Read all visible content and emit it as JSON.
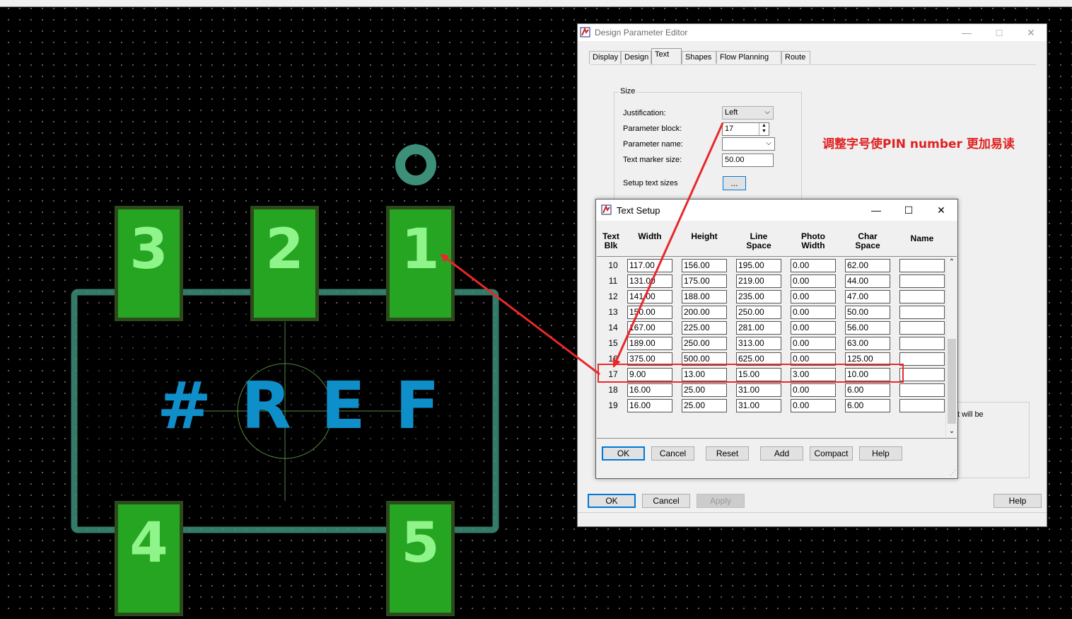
{
  "pcb": {
    "pads": [
      {
        "label": "3"
      },
      {
        "label": "2"
      },
      {
        "label": "1"
      },
      {
        "label": "4"
      },
      {
        "label": "5"
      }
    ],
    "refdes": "#REF",
    "colors": {
      "pad_fill": "#26a522",
      "pad_label": "#8ff58a",
      "outline": "#3d8f7a",
      "refdes": "#0f8fc9"
    }
  },
  "dpe": {
    "title": "Design Parameter Editor",
    "tabs": [
      "Display",
      "Design",
      "Text",
      "Shapes",
      "Flow Planning",
      "Route"
    ],
    "active_tab": "Text",
    "size_group": "Size",
    "justification_label": "Justification:",
    "justification_value": "Left",
    "param_block_label": "Parameter block:",
    "param_block_value": "17",
    "param_name_label": "Parameter name:",
    "param_name_value": "",
    "text_marker_label": "Text marker size:",
    "text_marker_value": "50.00",
    "setup_text_label": "Setup text sizes",
    "setup_text_button": "...",
    "partial_text": "t will be",
    "buttons": {
      "ok": "OK",
      "cancel": "Cancel",
      "apply": "Apply",
      "help": "Help"
    }
  },
  "text_setup": {
    "title": "Text Setup",
    "headers": {
      "blk": "Text\nBlk",
      "width": "Width",
      "height": "Height",
      "line": "Line\nSpace",
      "photo": "Photo\nWidth",
      "char": "Char\nSpace",
      "name": "Name"
    },
    "rows": [
      {
        "blk": "10",
        "width": "117.00",
        "height": "156.00",
        "line": "195.00",
        "photo": "0.00",
        "char": "62.00",
        "name": ""
      },
      {
        "blk": "11",
        "width": "131.00",
        "height": "175.00",
        "line": "219.00",
        "photo": "0.00",
        "char": "44.00",
        "name": ""
      },
      {
        "blk": "12",
        "width": "141.00",
        "height": "188.00",
        "line": "235.00",
        "photo": "0.00",
        "char": "47.00",
        "name": ""
      },
      {
        "blk": "13",
        "width": "150.00",
        "height": "200.00",
        "line": "250.00",
        "photo": "0.00",
        "char": "50.00",
        "name": ""
      },
      {
        "blk": "14",
        "width": "167.00",
        "height": "225.00",
        "line": "281.00",
        "photo": "0.00",
        "char": "56.00",
        "name": ""
      },
      {
        "blk": "15",
        "width": "189.00",
        "height": "250.00",
        "line": "313.00",
        "photo": "0.00",
        "char": "63.00",
        "name": ""
      },
      {
        "blk": "16",
        "width": "375.00",
        "height": "500.00",
        "line": "625.00",
        "photo": "0.00",
        "char": "125.00",
        "name": ""
      },
      {
        "blk": "17",
        "width": "9.00",
        "height": "13.00",
        "line": "15.00",
        "photo": "3.00",
        "char": "10.00",
        "name": ""
      },
      {
        "blk": "18",
        "width": "16.00",
        "height": "25.00",
        "line": "31.00",
        "photo": "0.00",
        "char": "6.00",
        "name": ""
      },
      {
        "blk": "19",
        "width": "16.00",
        "height": "25.00",
        "line": "31.00",
        "photo": "0.00",
        "char": "6.00",
        "name": ""
      }
    ],
    "highlighted_row": "17",
    "buttons": {
      "ok": "OK",
      "cancel": "Cancel",
      "reset": "Reset",
      "add": "Add",
      "compact": "Compact",
      "help": "Help"
    }
  },
  "annotation": {
    "text": "调整字号使PIN number 更加易读",
    "color": "#e02020"
  }
}
